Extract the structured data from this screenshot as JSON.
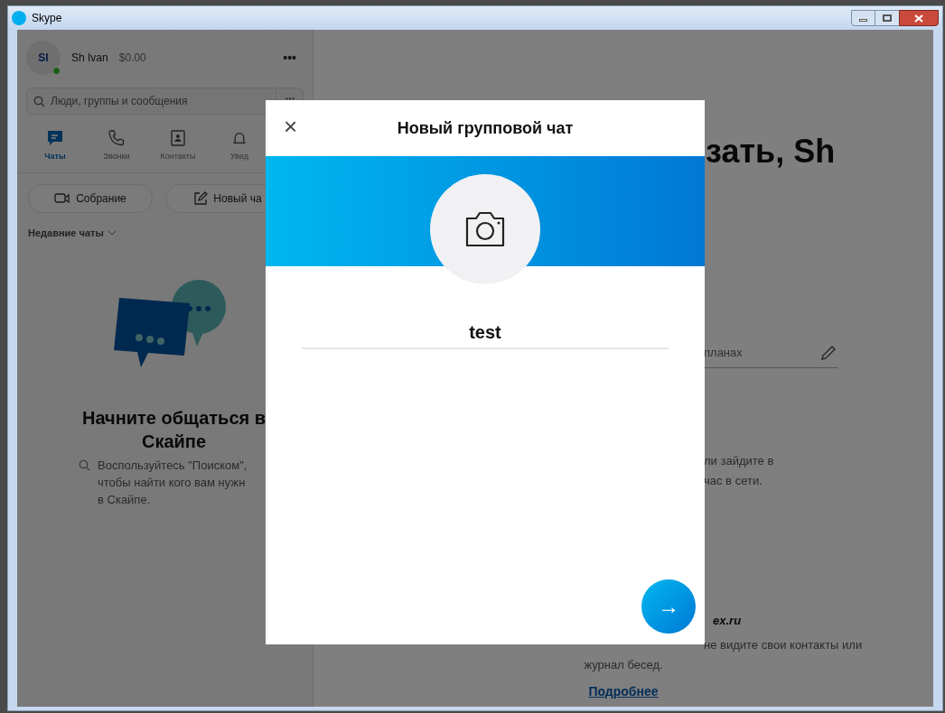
{
  "window": {
    "title": "Skype"
  },
  "profile": {
    "initials": "SI",
    "name": "Sh Ivan",
    "balance": "$0.00",
    "menu": "•••",
    "online": true
  },
  "search": {
    "placeholder": "Люди, группы и сообщения"
  },
  "nav_tabs": [
    {
      "label": "Чаты",
      "kind": "chat",
      "selected": true
    },
    {
      "label": "Звонки",
      "kind": "phone",
      "selected": false
    },
    {
      "label": "Контакты",
      "kind": "contacts",
      "selected": false
    },
    {
      "label": "Увед",
      "kind": "bell",
      "selected": false
    }
  ],
  "actions": [
    {
      "label": "Собрание",
      "kind": "meeting"
    },
    {
      "label": "Новый ча",
      "kind": "compose"
    }
  ],
  "recent_chats": {
    "label": "Недавние чаты"
  },
  "empty_state": {
    "title": "Начните общаться в Скайпе",
    "lines": [
      "Воспользуйтесь \"Поиском\",",
      "чтобы найти кого вам нужн",
      "в Скайпе."
    ]
  },
  "main": {
    "greeting": "зать, Sh",
    "mood": "планах",
    "hint_lines": [
      "ли зайдите в",
      "час в сети."
    ],
    "account": "ex.ru",
    "switch_line": "не видите свои контакты или",
    "switch_line_2": "журнал бесед.",
    "link": "Подробнее"
  },
  "dialog": {
    "title": "Новый групповой чат",
    "close": "×",
    "group_name": "test",
    "next": "→"
  }
}
